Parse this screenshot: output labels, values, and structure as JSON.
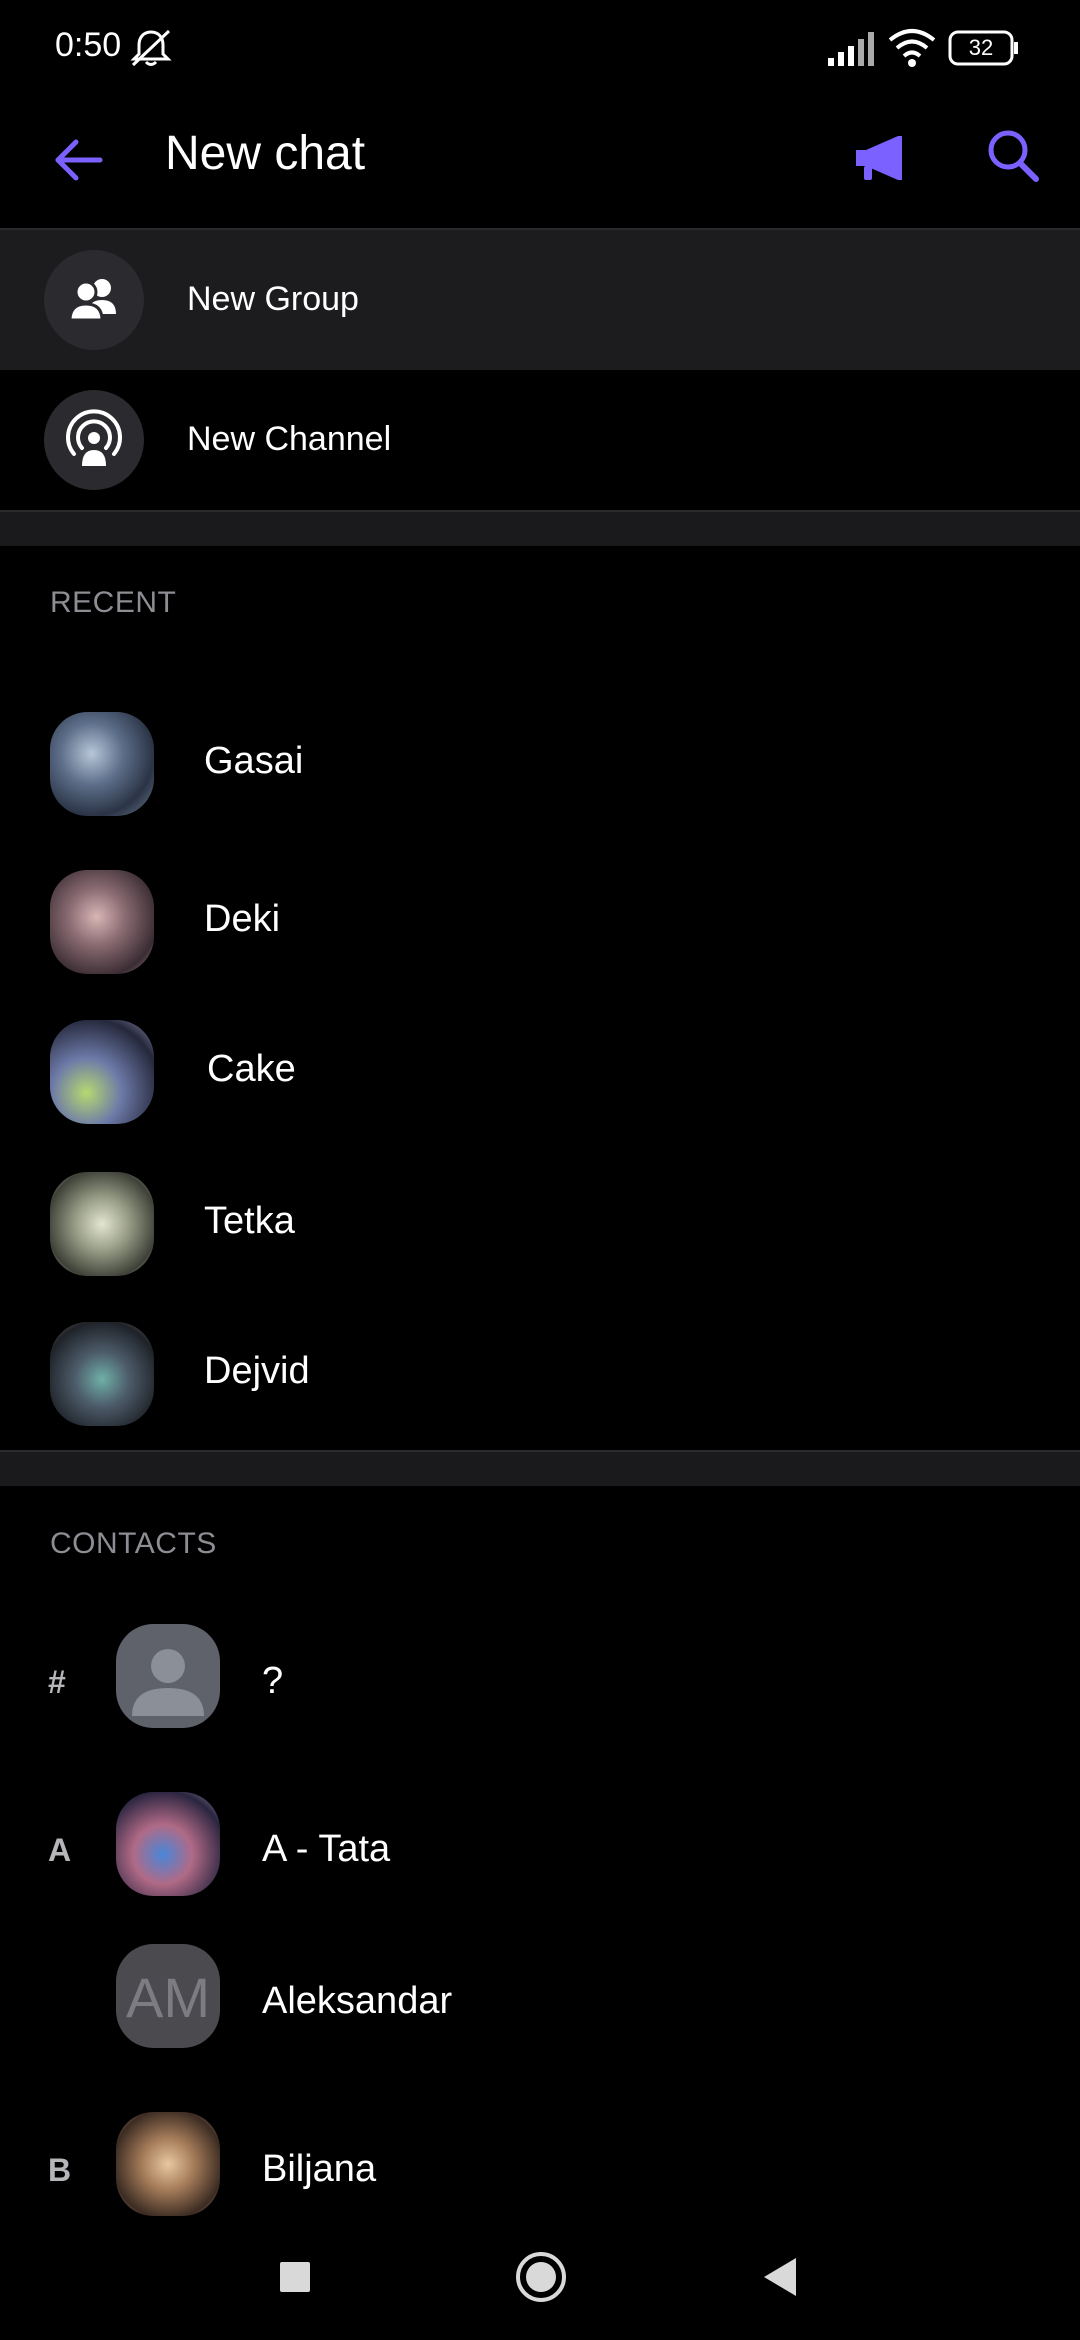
{
  "status_bar": {
    "time": "0:50",
    "battery": "32",
    "icons": [
      "mute-icon",
      "signal-icon",
      "wifi-icon",
      "battery-icon"
    ]
  },
  "header": {
    "title": "New chat",
    "icons": [
      "back-arrow-icon",
      "megaphone-icon",
      "search-icon"
    ],
    "accent_color": "#7b61ff"
  },
  "actions": [
    {
      "label": "New Group",
      "icon": "group-icon"
    },
    {
      "label": "New Channel",
      "icon": "channel-icon"
    }
  ],
  "recent": {
    "header": "RECENT",
    "items": [
      {
        "name": "Gasai"
      },
      {
        "name": "Deki"
      },
      {
        "name": "Cake"
      },
      {
        "name": "Tetka"
      },
      {
        "name": "Dejvid"
      }
    ]
  },
  "contacts": {
    "header": "CONTACTS",
    "items": [
      {
        "letter": "#",
        "name": "?",
        "avatar": "placeholder"
      },
      {
        "letter": "A",
        "name": "A - Tata",
        "avatar": "photo"
      },
      {
        "letter": "",
        "name": "Aleksandar",
        "avatar": "initials",
        "initials": "AM"
      },
      {
        "letter": "B",
        "name": "Biljana",
        "avatar": "photo"
      }
    ]
  },
  "nav_bar": {
    "icons": [
      "recents-square-icon",
      "home-circle-icon",
      "back-triangle-icon"
    ]
  }
}
